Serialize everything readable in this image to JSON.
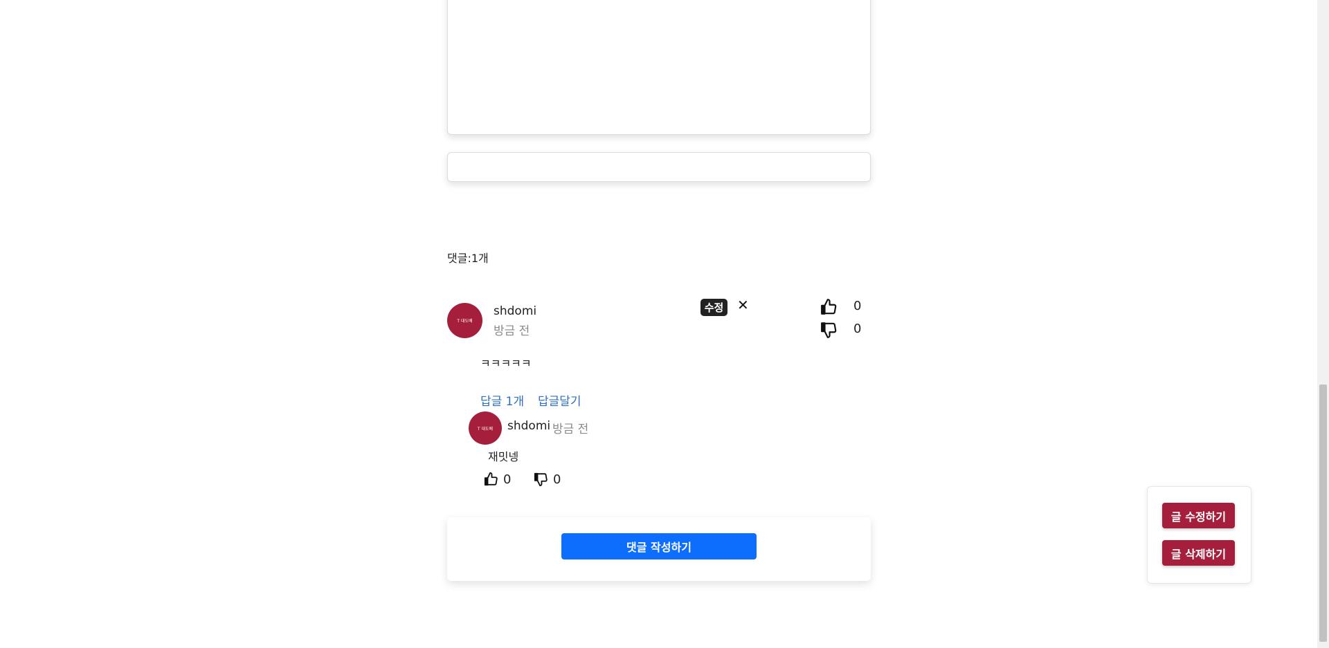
{
  "comments_header": "댓글:1개",
  "comment": {
    "author": "shdomi",
    "time": "방금 전",
    "edit_label": "수정",
    "delete_symbol": "✕",
    "likes": "0",
    "dislikes": "0",
    "body": "ㅋㅋㅋㅋㅋ",
    "replies_count_label": "답글 1개",
    "reply_action_label": "답글달기",
    "avatar_text": "T 대도배"
  },
  "reply": {
    "author": "shdomi",
    "time": "방금 전",
    "body": "재밋넹",
    "likes": "0",
    "dislikes": "0",
    "avatar_text": "T 대도배"
  },
  "write_comment_button": "댓글 작성하기",
  "side_panel": {
    "edit_post_button": "글 수정하기",
    "delete_post_button": "글 삭제하기"
  },
  "colors": {
    "brand_red": "#a51f3d",
    "primary_blue": "#0d6efd",
    "link_blue": "#2f6fbf"
  }
}
